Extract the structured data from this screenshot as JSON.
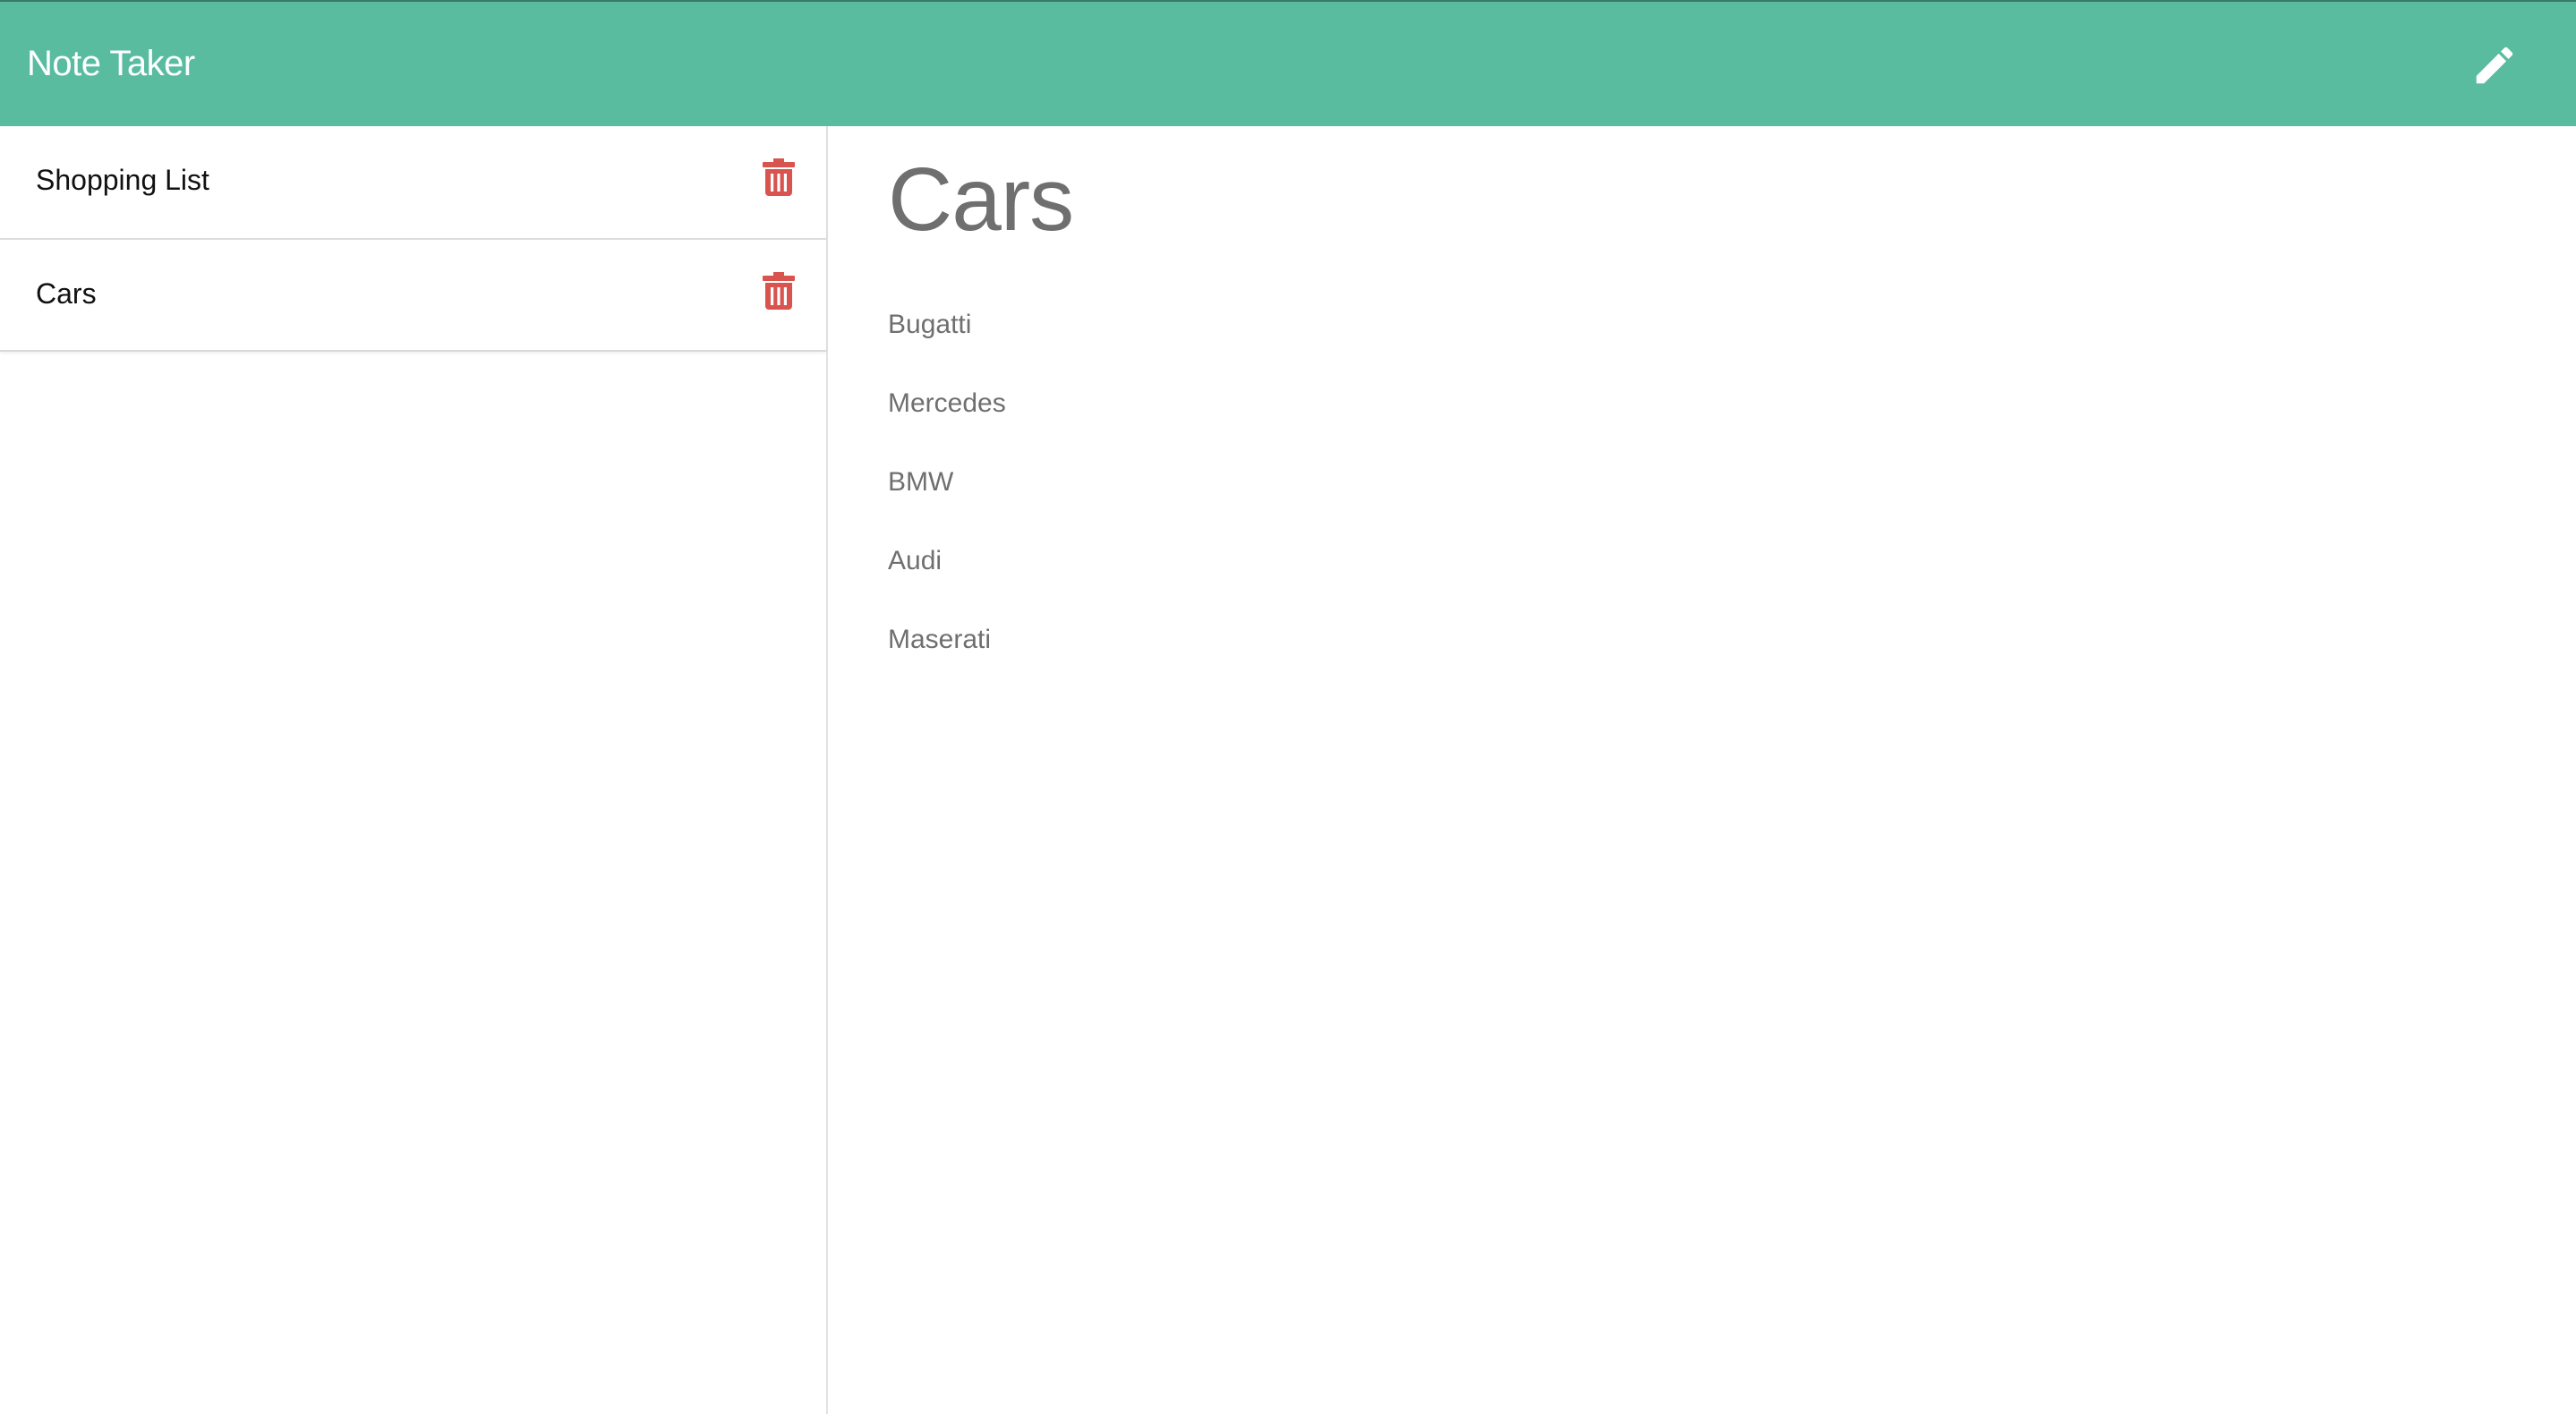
{
  "app": {
    "title": "Note Taker",
    "accent_color": "#59bc9f",
    "delete_color": "#d9534f"
  },
  "toolbar": {
    "new_note_icon": "pencil-icon"
  },
  "sidebar": {
    "notes": [
      {
        "title": "Shopping List",
        "icon": "trash-icon"
      },
      {
        "title": "Cars",
        "icon": "trash-icon"
      }
    ]
  },
  "editor": {
    "title": "Cars",
    "lines": [
      "Bugatti",
      "Mercedes",
      "BMW",
      "Audi",
      "Maserati"
    ]
  }
}
